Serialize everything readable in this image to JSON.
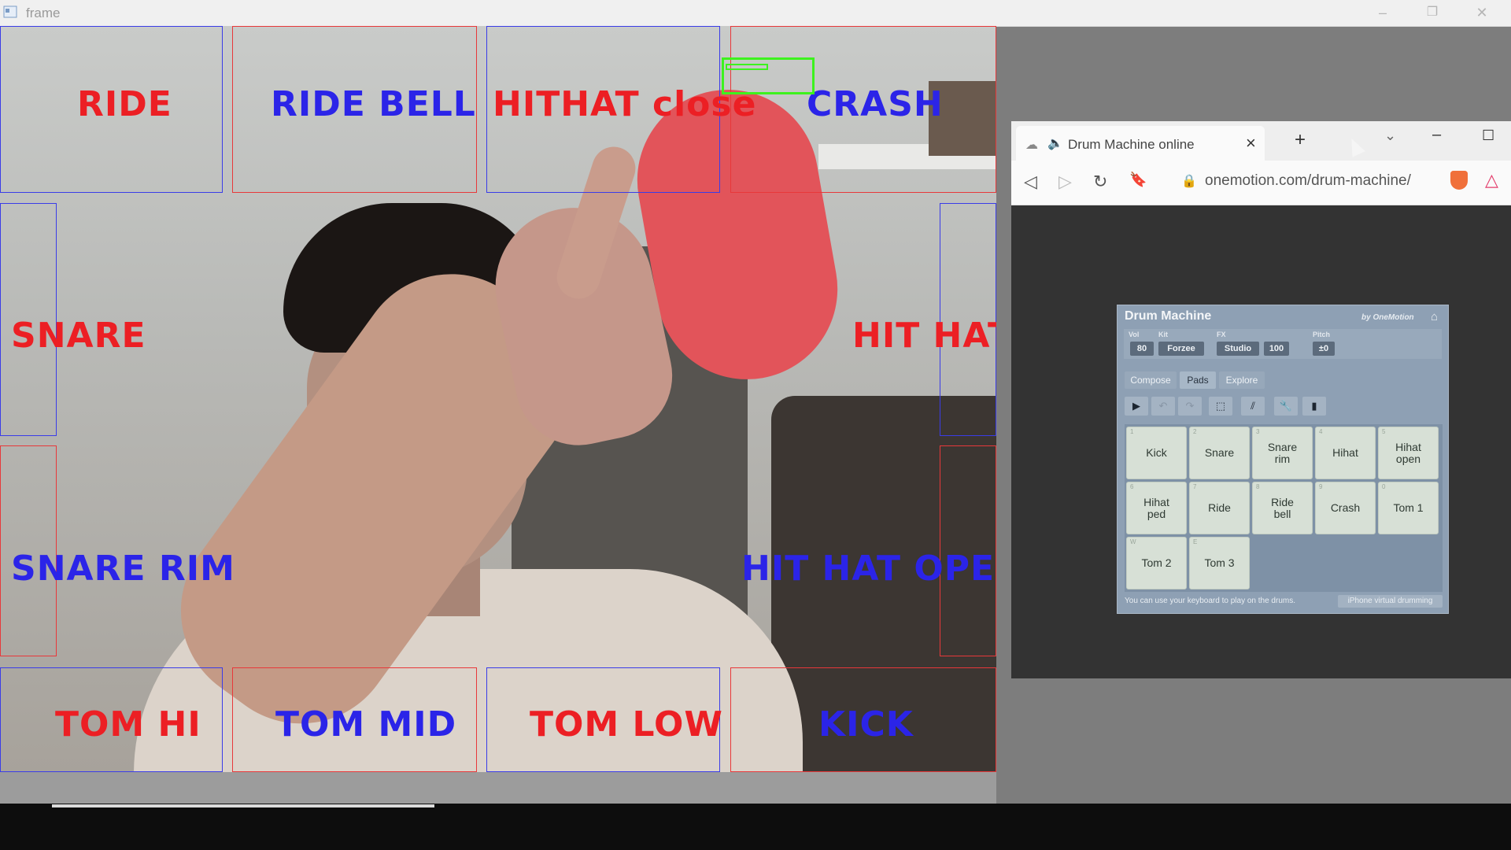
{
  "window": {
    "title": "frame",
    "minimize": "–",
    "restore": "❐",
    "close": "✕"
  },
  "zones": [
    {
      "id": "ride",
      "label": "RIDE",
      "color": "red"
    },
    {
      "id": "ride-bell",
      "label": "RIDE  BELL",
      "color": "blue"
    },
    {
      "id": "hithat-close",
      "label": "HITHAT  close",
      "color": "red"
    },
    {
      "id": "crash",
      "label": "CRASH",
      "color": "blue"
    },
    {
      "id": "snare",
      "label": "SNARE",
      "color": "red"
    },
    {
      "id": "hit-hat",
      "label": "HIT  HAT",
      "color": "red"
    },
    {
      "id": "snare-rim",
      "label": "SNARE  RIM",
      "color": "blue"
    },
    {
      "id": "hit-hat-open",
      "label": "HIT  HAT  OPEN",
      "color": "blue"
    },
    {
      "id": "tom-hi",
      "label": "TOM  HI",
      "color": "red"
    },
    {
      "id": "tom-mid",
      "label": "TOM  MID",
      "color": "blue"
    },
    {
      "id": "tom-low",
      "label": "TOM  LOW",
      "color": "red"
    },
    {
      "id": "kick",
      "label": "KICK",
      "color": "blue"
    }
  ],
  "browser": {
    "tab_title": "Drum Machine online",
    "new_tab": "+",
    "url": "onemotion.com/drum-machine/"
  },
  "drum_machine": {
    "title": "Drum Machine",
    "by": "by OneMotion",
    "controls": {
      "vol": {
        "label": "Vol",
        "value": "80"
      },
      "kit": {
        "label": "Kit",
        "value": "Forzee"
      },
      "fx": {
        "label": "FX",
        "value": "Studio",
        "amount": "100"
      },
      "pitch": {
        "label": "Pitch",
        "value": "±0"
      }
    },
    "tabs": [
      "Compose",
      "Pads",
      "Explore"
    ],
    "active_tab": "Pads",
    "pads": [
      {
        "key": "1",
        "label": "Kick"
      },
      {
        "key": "2",
        "label": "Snare"
      },
      {
        "key": "3",
        "label": "Snare rim"
      },
      {
        "key": "4",
        "label": "Hihat"
      },
      {
        "key": "5",
        "label": "Hihat open"
      },
      {
        "key": "6",
        "label": "Hihat ped"
      },
      {
        "key": "7",
        "label": "Ride"
      },
      {
        "key": "8",
        "label": "Ride bell"
      },
      {
        "key": "9",
        "label": "Crash"
      },
      {
        "key": "0",
        "label": "Tom 1"
      },
      {
        "key": "W",
        "label": "Tom 2"
      },
      {
        "key": "E",
        "label": "Tom 3"
      }
    ],
    "footer_text": "You can use your keyboard to play on the drums.",
    "footer_button": "iPhone virtual drumming"
  },
  "colors": {
    "zone_red": "#ec1f24",
    "zone_blue": "#2b24e8",
    "tracker_green": "#3df21e",
    "widget_bg": "#8ea0b4",
    "pad_bg": "#d7e0d6"
  }
}
